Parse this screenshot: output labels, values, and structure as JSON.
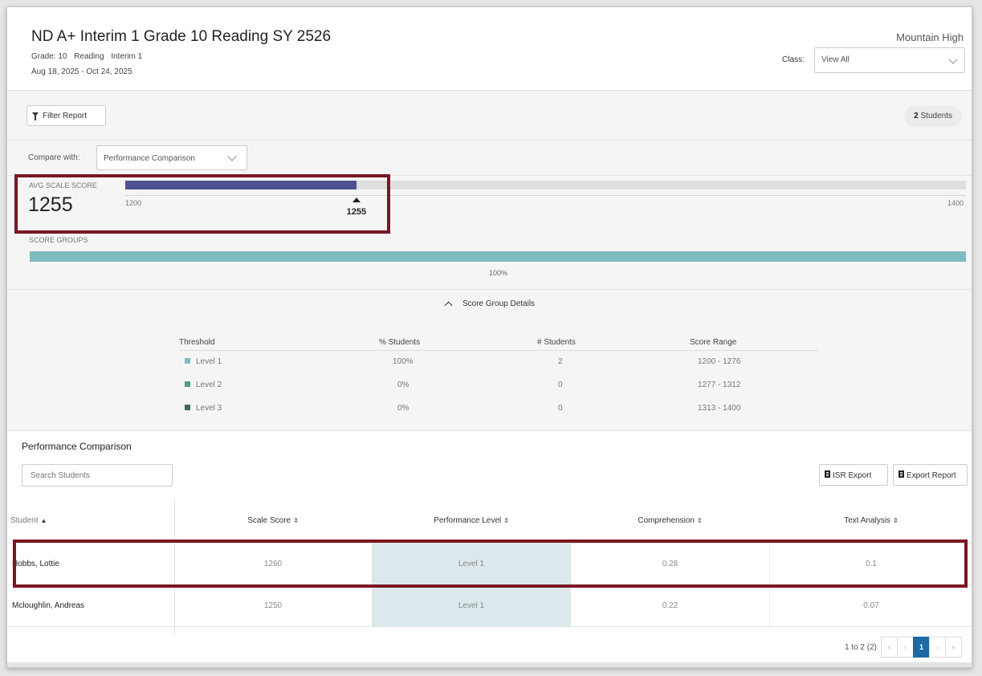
{
  "header": {
    "title": "ND A+ Interim 1 Grade 10 Reading SY 2526",
    "grade": "Grade: 10",
    "subject": "Reading",
    "period": "Interim 1",
    "date_range": "Aug 18, 2025 - Oct 24, 2025",
    "school": "Mountain High",
    "class_label": "Class:",
    "class_value": "View All"
  },
  "toolbar": {
    "filter_label": "Filter Report",
    "students_count": "2",
    "students_label": "Students"
  },
  "compare": {
    "label": "Compare with:",
    "value": "Performance Comparison"
  },
  "avg_scale_score": {
    "label": "AVG SCALE SCORE",
    "value": "1255",
    "min": "1200",
    "max": "1400",
    "marker": "1255",
    "fill_fraction": 0.275
  },
  "score_groups": {
    "label": "SCORE GROUPS",
    "percent": "100%",
    "color": "#7fbcc0"
  },
  "score_group_details": {
    "toggle_label": "Score Group Details",
    "headers": [
      "Threshold",
      "% Students",
      "# Students",
      "Score Range"
    ],
    "rows": [
      {
        "level": "Level 1",
        "pct": "100%",
        "count": "2",
        "range": "1200 - 1276",
        "color": "#7fbcc0"
      },
      {
        "level": "Level 2",
        "pct": "0%",
        "count": "0",
        "range": "1277 - 1312",
        "color": "#4f9a8c"
      },
      {
        "level": "Level 3",
        "pct": "0%",
        "count": "0",
        "range": "1313 - 1400",
        "color": "#3d6b4f"
      }
    ]
  },
  "performance": {
    "title": "Performance Comparison",
    "search_placeholder": "Search Students",
    "isr_export": "ISR Export",
    "export_report": "Export Report",
    "columns": [
      "Student",
      "Scale Score",
      "Performance Level",
      "Comprehension",
      "Text Analysis"
    ],
    "rows": [
      {
        "student": "Hobbs, Lottie",
        "scale": "1260",
        "level": "Level 1",
        "comp": "0.28",
        "text": "0.1"
      },
      {
        "student": "Mcloughlin, Andreas",
        "scale": "1250",
        "level": "Level 1",
        "comp": "0.22",
        "text": "0.07"
      }
    ],
    "pager_info": "1 to 2 (2)",
    "current_page": "1"
  },
  "colors": {
    "avg_fill": "#4d5290",
    "highlight_box": "#7a1623",
    "level_cell": "#dce9ec",
    "pager_active": "#1f6aa5"
  }
}
